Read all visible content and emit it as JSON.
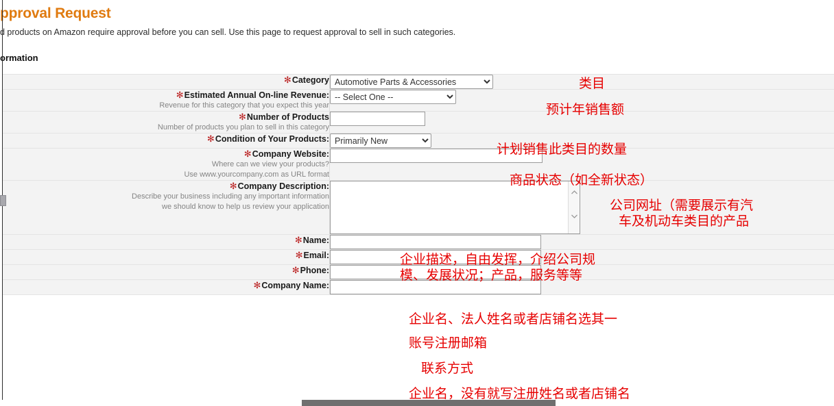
{
  "page": {
    "title": "pproval Request",
    "intro": "d products on Amazon require approval before you can sell. Use this page to request approval to sell in such categories.",
    "section_heading": "ormation"
  },
  "colors": {
    "title": "#e07b10",
    "required_asterisk": "#bb2222",
    "annotation": "#e60000",
    "row_background": "#f3f3f3"
  },
  "form": {
    "rows": [
      {
        "label": "Category",
        "required": true,
        "hints": [],
        "control": "select",
        "value": "Automotive Parts & Accessories"
      },
      {
        "label": "Estimated Annual On-line Revenue:",
        "required": true,
        "hints": [
          "Revenue for this category that you expect this year"
        ],
        "control": "select",
        "value": "-- Select One --"
      },
      {
        "label": "Number of Products",
        "required": true,
        "hints": [
          "Number of products you plan to sell in this category"
        ],
        "control": "input",
        "value": ""
      },
      {
        "label": "Condition of Your Products:",
        "required": true,
        "hints": [],
        "control": "select",
        "value": "Primarily New"
      },
      {
        "label": "Company Website:",
        "required": true,
        "hints": [
          "Where can we view your products?",
          "Use www.yourcompany.com as URL format"
        ],
        "control": "input",
        "value": ""
      },
      {
        "label": "Company Description:",
        "required": true,
        "hints": [
          "Describe your business including any important information",
          "we should know to help us review your application"
        ],
        "control": "textarea",
        "value": ""
      },
      {
        "label": "Name:",
        "required": true,
        "hints": [],
        "control": "input",
        "value": ""
      },
      {
        "label": "Email:",
        "required": true,
        "hints": [],
        "control": "input",
        "value": ""
      },
      {
        "label": "Phone:",
        "required": true,
        "hints": [],
        "control": "input",
        "value": ""
      },
      {
        "label": "Company Name:",
        "required": true,
        "hints": [],
        "control": "input",
        "value": ""
      }
    ],
    "required_marker": "✻"
  },
  "annotations": {
    "category": "类目",
    "revenue": "预计年销售额",
    "number_of_products": "计划销售此类目的数量",
    "condition": "商品状态（如全新状态）",
    "website_line1": "公司网址（需要展示有汽",
    "website_line2": "车及机动车类目的产品",
    "description_line1": "企业描述，自由发挥，介绍公司规",
    "description_line2": "模、发展状况；产品，服务等等",
    "name": "企业名、法人姓名或者店铺名选其一",
    "email": "账号注册邮箱",
    "phone": "联系方式",
    "company_name": "企业名，没有就写注册姓名或者店铺名"
  },
  "icons": {
    "dropdown": "chevron-down-icon",
    "scroll_up": "chevron-up-icon",
    "scroll_down": "chevron-down-icon"
  }
}
